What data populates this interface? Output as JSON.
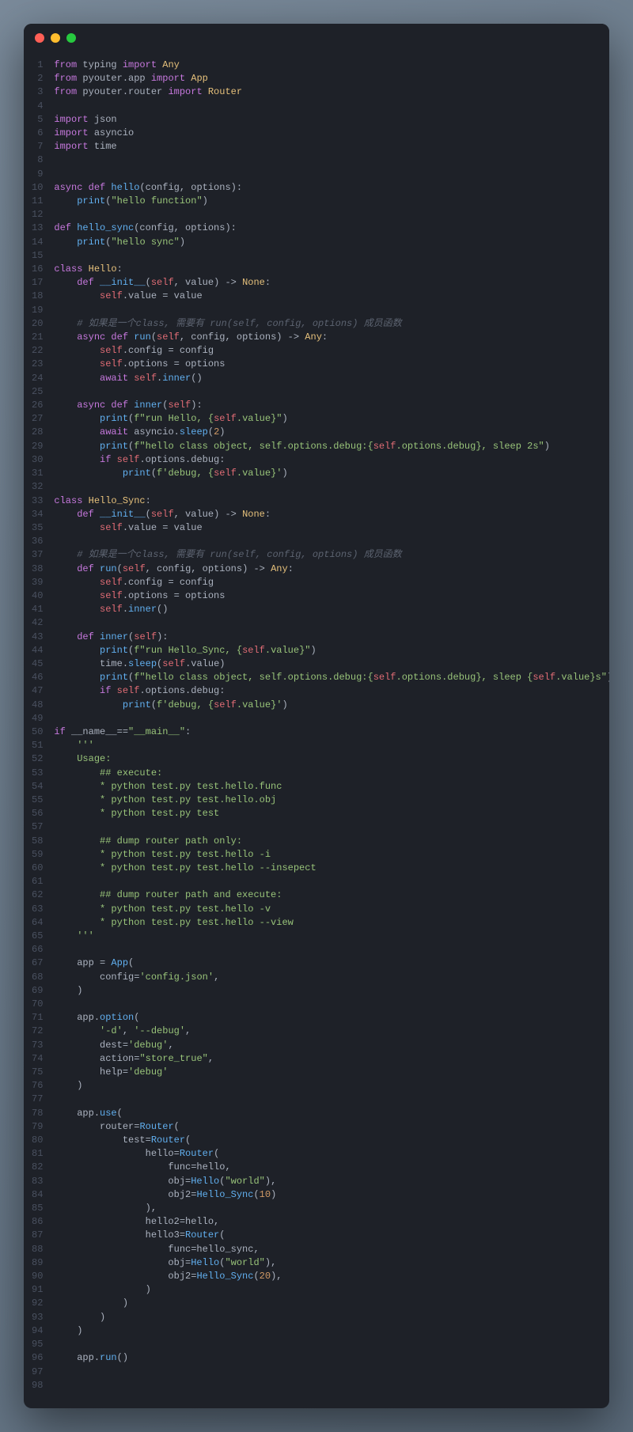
{
  "window": {
    "traffic_lights": [
      "close",
      "minimize",
      "zoom"
    ]
  },
  "code": {
    "lines": [
      [
        [
          "kw",
          "from"
        ],
        [
          "op",
          " typing "
        ],
        [
          "kw",
          "import"
        ],
        [
          "op",
          " "
        ],
        [
          "cn",
          "Any"
        ]
      ],
      [
        [
          "kw",
          "from"
        ],
        [
          "op",
          " pyouter.app "
        ],
        [
          "kw",
          "import"
        ],
        [
          "op",
          " "
        ],
        [
          "cn",
          "App"
        ]
      ],
      [
        [
          "kw",
          "from"
        ],
        [
          "op",
          " pyouter.router "
        ],
        [
          "kw",
          "import"
        ],
        [
          "op",
          " "
        ],
        [
          "cn",
          "Router"
        ]
      ],
      [],
      [
        [
          "kw",
          "import"
        ],
        [
          "op",
          " json"
        ]
      ],
      [
        [
          "kw",
          "import"
        ],
        [
          "op",
          " asyncio"
        ]
      ],
      [
        [
          "kw",
          "import"
        ],
        [
          "op",
          " time"
        ]
      ],
      [],
      [],
      [
        [
          "kw",
          "async def "
        ],
        [
          "fn",
          "hello"
        ],
        [
          "op",
          "(config, options):"
        ]
      ],
      [
        [
          "op",
          "    "
        ],
        [
          "fn",
          "print"
        ],
        [
          "op",
          "("
        ],
        [
          "st",
          "\"hello function\""
        ],
        [
          "op",
          ")"
        ]
      ],
      [],
      [
        [
          "kw",
          "def "
        ],
        [
          "fn",
          "hello_sync"
        ],
        [
          "op",
          "(config, options):"
        ]
      ],
      [
        [
          "op",
          "    "
        ],
        [
          "fn",
          "print"
        ],
        [
          "op",
          "("
        ],
        [
          "st",
          "\"hello sync\""
        ],
        [
          "op",
          ")"
        ]
      ],
      [],
      [
        [
          "kw",
          "class "
        ],
        [
          "cn",
          "Hello"
        ],
        [
          "op",
          ":"
        ]
      ],
      [
        [
          "op",
          "    "
        ],
        [
          "kw",
          "def "
        ],
        [
          "fn",
          "__init__"
        ],
        [
          "op",
          "("
        ],
        [
          "sf",
          "self"
        ],
        [
          "op",
          ", value) -> "
        ],
        [
          "cn",
          "None"
        ],
        [
          "op",
          ":"
        ]
      ],
      [
        [
          "op",
          "        "
        ],
        [
          "sf",
          "self"
        ],
        [
          "op",
          ".value = value"
        ]
      ],
      [],
      [
        [
          "op",
          "    "
        ],
        [
          "cm",
          "# 如果是一个class, 需要有 run(self, config, options) 成员函数"
        ]
      ],
      [
        [
          "op",
          "    "
        ],
        [
          "kw",
          "async def "
        ],
        [
          "fn",
          "run"
        ],
        [
          "op",
          "("
        ],
        [
          "sf",
          "self"
        ],
        [
          "op",
          ", config, options) -> "
        ],
        [
          "cn",
          "Any"
        ],
        [
          "op",
          ":"
        ]
      ],
      [
        [
          "op",
          "        "
        ],
        [
          "sf",
          "self"
        ],
        [
          "op",
          ".config = config"
        ]
      ],
      [
        [
          "op",
          "        "
        ],
        [
          "sf",
          "self"
        ],
        [
          "op",
          ".options = options"
        ]
      ],
      [
        [
          "op",
          "        "
        ],
        [
          "kw",
          "await "
        ],
        [
          "sf",
          "self"
        ],
        [
          "op",
          "."
        ],
        [
          "fn",
          "inner"
        ],
        [
          "op",
          "()"
        ]
      ],
      [],
      [
        [
          "op",
          "    "
        ],
        [
          "kw",
          "async def "
        ],
        [
          "fn",
          "inner"
        ],
        [
          "op",
          "("
        ],
        [
          "sf",
          "self"
        ],
        [
          "op",
          "):"
        ]
      ],
      [
        [
          "op",
          "        "
        ],
        [
          "fn",
          "print"
        ],
        [
          "op",
          "("
        ],
        [
          "st",
          "f\"run Hello, {"
        ],
        [
          "sf",
          "self"
        ],
        [
          "st",
          ".value}\""
        ],
        [
          "op",
          ")"
        ]
      ],
      [
        [
          "op",
          "        "
        ],
        [
          "kw",
          "await "
        ],
        [
          "op",
          "asyncio."
        ],
        [
          "fn",
          "sleep"
        ],
        [
          "op",
          "("
        ],
        [
          "nm",
          "2"
        ],
        [
          "op",
          ")"
        ]
      ],
      [
        [
          "op",
          "        "
        ],
        [
          "fn",
          "print"
        ],
        [
          "op",
          "("
        ],
        [
          "st",
          "f\"hello class object, self.options.debug:{"
        ],
        [
          "sf",
          "self"
        ],
        [
          "st",
          ".options.debug}, sleep 2s\""
        ],
        [
          "op",
          ")"
        ]
      ],
      [
        [
          "op",
          "        "
        ],
        [
          "kw",
          "if "
        ],
        [
          "sf",
          "self"
        ],
        [
          "op",
          ".options.debug:"
        ]
      ],
      [
        [
          "op",
          "            "
        ],
        [
          "fn",
          "print"
        ],
        [
          "op",
          "("
        ],
        [
          "st",
          "f'debug, {"
        ],
        [
          "sf",
          "self"
        ],
        [
          "st",
          ".value}'"
        ],
        [
          "op",
          ")"
        ]
      ],
      [],
      [
        [
          "kw",
          "class "
        ],
        [
          "cn",
          "Hello_Sync"
        ],
        [
          "op",
          ":"
        ]
      ],
      [
        [
          "op",
          "    "
        ],
        [
          "kw",
          "def "
        ],
        [
          "fn",
          "__init__"
        ],
        [
          "op",
          "("
        ],
        [
          "sf",
          "self"
        ],
        [
          "op",
          ", value) -> "
        ],
        [
          "cn",
          "None"
        ],
        [
          "op",
          ":"
        ]
      ],
      [
        [
          "op",
          "        "
        ],
        [
          "sf",
          "self"
        ],
        [
          "op",
          ".value = value"
        ]
      ],
      [],
      [
        [
          "op",
          "    "
        ],
        [
          "cm",
          "# 如果是一个class, 需要有 run(self, config, options) 成员函数"
        ]
      ],
      [
        [
          "op",
          "    "
        ],
        [
          "kw",
          "def "
        ],
        [
          "fn",
          "run"
        ],
        [
          "op",
          "("
        ],
        [
          "sf",
          "self"
        ],
        [
          "op",
          ", config, options) -> "
        ],
        [
          "cn",
          "Any"
        ],
        [
          "op",
          ":"
        ]
      ],
      [
        [
          "op",
          "        "
        ],
        [
          "sf",
          "self"
        ],
        [
          "op",
          ".config = config"
        ]
      ],
      [
        [
          "op",
          "        "
        ],
        [
          "sf",
          "self"
        ],
        [
          "op",
          ".options = options"
        ]
      ],
      [
        [
          "op",
          "        "
        ],
        [
          "sf",
          "self"
        ],
        [
          "op",
          "."
        ],
        [
          "fn",
          "inner"
        ],
        [
          "op",
          "()"
        ]
      ],
      [],
      [
        [
          "op",
          "    "
        ],
        [
          "kw",
          "def "
        ],
        [
          "fn",
          "inner"
        ],
        [
          "op",
          "("
        ],
        [
          "sf",
          "self"
        ],
        [
          "op",
          "):"
        ]
      ],
      [
        [
          "op",
          "        "
        ],
        [
          "fn",
          "print"
        ],
        [
          "op",
          "("
        ],
        [
          "st",
          "f\"run Hello_Sync, {"
        ],
        [
          "sf",
          "self"
        ],
        [
          "st",
          ".value}\""
        ],
        [
          "op",
          ")"
        ]
      ],
      [
        [
          "op",
          "        time."
        ],
        [
          "fn",
          "sleep"
        ],
        [
          "op",
          "("
        ],
        [
          "sf",
          "self"
        ],
        [
          "op",
          ".value)"
        ]
      ],
      [
        [
          "op",
          "        "
        ],
        [
          "fn",
          "print"
        ],
        [
          "op",
          "("
        ],
        [
          "st",
          "f\"hello class object, self.options.debug:{"
        ],
        [
          "sf",
          "self"
        ],
        [
          "st",
          ".options.debug}, sleep {"
        ],
        [
          "sf",
          "self"
        ],
        [
          "st",
          ".value}s\""
        ],
        [
          "op",
          ")"
        ]
      ],
      [
        [
          "op",
          "        "
        ],
        [
          "kw",
          "if "
        ],
        [
          "sf",
          "self"
        ],
        [
          "op",
          ".options.debug:"
        ]
      ],
      [
        [
          "op",
          "            "
        ],
        [
          "fn",
          "print"
        ],
        [
          "op",
          "("
        ],
        [
          "st",
          "f'debug, {"
        ],
        [
          "sf",
          "self"
        ],
        [
          "st",
          ".value}'"
        ],
        [
          "op",
          ")"
        ]
      ],
      [],
      [
        [
          "kw",
          "if "
        ],
        [
          "op",
          "__name__=="
        ],
        [
          "st",
          "\"__main__\""
        ],
        [
          "op",
          ":"
        ]
      ],
      [
        [
          "op",
          "    "
        ],
        [
          "st",
          "'''"
        ]
      ],
      [
        [
          "op",
          "    "
        ],
        [
          "st",
          "Usage:"
        ]
      ],
      [
        [
          "op",
          "        "
        ],
        [
          "st",
          "## execute:"
        ]
      ],
      [
        [
          "op",
          "        "
        ],
        [
          "st",
          "* python test.py test.hello.func"
        ]
      ],
      [
        [
          "op",
          "        "
        ],
        [
          "st",
          "* python test.py test.hello.obj"
        ]
      ],
      [
        [
          "op",
          "        "
        ],
        [
          "st",
          "* python test.py test"
        ]
      ],
      [],
      [
        [
          "op",
          "        "
        ],
        [
          "st",
          "## dump router path only:"
        ]
      ],
      [
        [
          "op",
          "        "
        ],
        [
          "st",
          "* python test.py test.hello -i"
        ]
      ],
      [
        [
          "op",
          "        "
        ],
        [
          "st",
          "* python test.py test.hello --insepect"
        ]
      ],
      [],
      [
        [
          "op",
          "        "
        ],
        [
          "st",
          "## dump router path and execute:"
        ]
      ],
      [
        [
          "op",
          "        "
        ],
        [
          "st",
          "* python test.py test.hello -v"
        ]
      ],
      [
        [
          "op",
          "        "
        ],
        [
          "st",
          "* python test.py test.hello --view"
        ]
      ],
      [
        [
          "op",
          "    "
        ],
        [
          "st",
          "'''"
        ]
      ],
      [],
      [
        [
          "op",
          "    app = "
        ],
        [
          "fn",
          "App"
        ],
        [
          "op",
          "("
        ]
      ],
      [
        [
          "op",
          "        config="
        ],
        [
          "st",
          "'config.json'"
        ],
        [
          "op",
          ","
        ]
      ],
      [
        [
          "op",
          "    )"
        ]
      ],
      [],
      [
        [
          "op",
          "    app."
        ],
        [
          "fn",
          "option"
        ],
        [
          "op",
          "("
        ]
      ],
      [
        [
          "op",
          "        "
        ],
        [
          "st",
          "'-d'"
        ],
        [
          "op",
          ", "
        ],
        [
          "st",
          "'--debug'"
        ],
        [
          "op",
          ","
        ]
      ],
      [
        [
          "op",
          "        dest="
        ],
        [
          "st",
          "'debug'"
        ],
        [
          "op",
          ","
        ]
      ],
      [
        [
          "op",
          "        action="
        ],
        [
          "st",
          "\"store_true\""
        ],
        [
          "op",
          ","
        ]
      ],
      [
        [
          "op",
          "        help="
        ],
        [
          "st",
          "'debug'"
        ]
      ],
      [
        [
          "op",
          "    )"
        ]
      ],
      [],
      [
        [
          "op",
          "    app."
        ],
        [
          "fn",
          "use"
        ],
        [
          "op",
          "("
        ]
      ],
      [
        [
          "op",
          "        router="
        ],
        [
          "fn",
          "Router"
        ],
        [
          "op",
          "("
        ]
      ],
      [
        [
          "op",
          "            test="
        ],
        [
          "fn",
          "Router"
        ],
        [
          "op",
          "("
        ]
      ],
      [
        [
          "op",
          "                hello="
        ],
        [
          "fn",
          "Router"
        ],
        [
          "op",
          "("
        ]
      ],
      [
        [
          "op",
          "                    func=hello,"
        ]
      ],
      [
        [
          "op",
          "                    obj="
        ],
        [
          "fn",
          "Hello"
        ],
        [
          "op",
          "("
        ],
        [
          "st",
          "\"world\""
        ],
        [
          "op",
          "),"
        ]
      ],
      [
        [
          "op",
          "                    obj2="
        ],
        [
          "fn",
          "Hello_Sync"
        ],
        [
          "op",
          "("
        ],
        [
          "nm",
          "10"
        ],
        [
          "op",
          ")"
        ]
      ],
      [
        [
          "op",
          "                ),"
        ]
      ],
      [
        [
          "op",
          "                hello2=hello,"
        ]
      ],
      [
        [
          "op",
          "                hello3="
        ],
        [
          "fn",
          "Router"
        ],
        [
          "op",
          "("
        ]
      ],
      [
        [
          "op",
          "                    func=hello_sync,"
        ]
      ],
      [
        [
          "op",
          "                    obj="
        ],
        [
          "fn",
          "Hello"
        ],
        [
          "op",
          "("
        ],
        [
          "st",
          "\"world\""
        ],
        [
          "op",
          "),"
        ]
      ],
      [
        [
          "op",
          "                    obj2="
        ],
        [
          "fn",
          "Hello_Sync"
        ],
        [
          "op",
          "("
        ],
        [
          "nm",
          "20"
        ],
        [
          "op",
          "),"
        ]
      ],
      [
        [
          "op",
          "                )"
        ]
      ],
      [
        [
          "op",
          "            )"
        ]
      ],
      [
        [
          "op",
          "        )"
        ]
      ],
      [
        [
          "op",
          "    )"
        ]
      ],
      [],
      [
        [
          "op",
          "    app."
        ],
        [
          "fn",
          "run"
        ],
        [
          "op",
          "()"
        ]
      ],
      [],
      []
    ]
  }
}
